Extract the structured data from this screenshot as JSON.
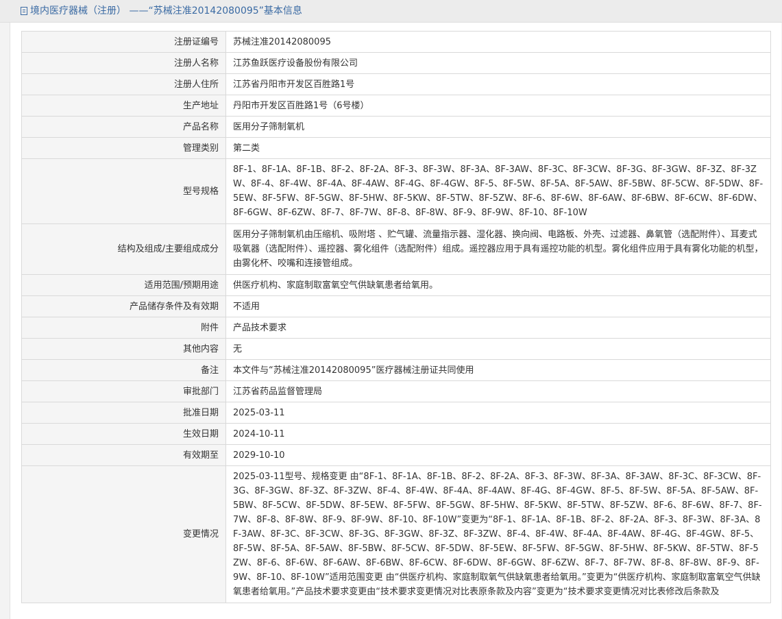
{
  "header": {
    "icon": "document-icon",
    "title": "境内医疗器械（注册） ——“苏械注准20142080095”基本信息"
  },
  "rows": [
    {
      "label": "注册证编号",
      "value": "苏械注准20142080095"
    },
    {
      "label": "注册人名称",
      "value": "江苏鱼跃医疗设备股份有限公司"
    },
    {
      "label": "注册人住所",
      "value": "江苏省丹阳市开发区百胜路1号"
    },
    {
      "label": "生产地址",
      "value": "丹阳市开发区百胜路1号（6号楼）"
    },
    {
      "label": "产品名称",
      "value": "医用分子筛制氧机"
    },
    {
      "label": "管理类别",
      "value": "第二类"
    },
    {
      "label": "型号规格",
      "value": "8F-1、8F-1A、8F-1B、8F-2、8F-2A、8F-3、8F-3W、8F-3A、8F-3AW、8F-3C、8F-3CW、8F-3G、8F-3GW、8F-3Z、8F-3ZW、8F-4、8F-4W、8F-4A、8F-4AW、8F-4G、8F-4GW、8F-5、8F-5W、8F-5A、8F-5AW、8F-5BW、8F-5CW、8F-5DW、8F-5EW、8F-5FW、8F-5GW、8F-5HW、8F-5KW、8F-5TW、8F-5ZW、8F-6、8F-6W、8F-6AW、8F-6BW、8F-6CW、8F-6DW、8F-6GW、8F-6ZW、8F-7、8F-7W、8F-8、8F-8W、8F-9、8F-9W、8F-10、8F-10W"
    },
    {
      "label": "结构及组成/主要组成成分",
      "value": "医用分子筛制氧机由压缩机、吸附塔 、贮气罐、流量指示器、湿化器、换向阀、电路板、外壳、过滤器、鼻氧管（选配附件）、耳麦式吸氧器（选配附件）、遥控器、雾化组件（选配附件）组成。遥控器应用于具有遥控功能的机型。雾化组件应用于具有雾化功能的机型，由雾化杯、咬嘴和连接管组成。"
    },
    {
      "label": "适用范围/预期用途",
      "value": "供医疗机构、家庭制取富氧空气供缺氧患者给氧用。"
    },
    {
      "label": "产品储存条件及有效期",
      "value": "不适用"
    },
    {
      "label": "附件",
      "value": "产品技术要求"
    },
    {
      "label": "其他内容",
      "value": "无"
    },
    {
      "label": "备注",
      "value": "本文件与“苏械注准20142080095”医疗器械注册证共同使用"
    },
    {
      "label": "审批部门",
      "value": "江苏省药品监督管理局"
    },
    {
      "label": "批准日期",
      "value": "2025-03-11"
    },
    {
      "label": "生效日期",
      "value": "2024-10-11"
    },
    {
      "label": "有效期至",
      "value": "2029-10-10"
    },
    {
      "label": "变更情况",
      "value": "2025-03-11型号、规格变更 由“8F-1、8F-1A、8F-1B、8F-2、8F-2A、8F-3、8F-3W、8F-3A、8F-3AW、8F-3C、8F-3CW、8F-3G、8F-3GW、8F-3Z、8F-3ZW、8F-4、8F-4W、8F-4A、8F-4AW、8F-4G、8F-4GW、8F-5、8F-5W、8F-5A、8F-5AW、8F-5BW、8F-5CW、8F-5DW、8F-5EW、8F-5FW、8F-5GW、8F-5HW、8F-5KW、8F-5TW、8F-5ZW、8F-6、8F-6W、8F-7、8F-7W、8F-8、8F-8W、8F-9、8F-9W、8F-10、8F-10W”变更为“8F-1、8F-1A、8F-1B、8F-2、8F-2A、8F-3、8F-3W、8F-3A、8F-3AW、8F-3C、8F-3CW、8F-3G、8F-3GW、8F-3Z、8F-3ZW、8F-4、8F-4W、8F-4A、8F-4AW、8F-4G、8F-4GW、8F-5、8F-5W、8F-5A、8F-5AW、8F-5BW、8F-5CW、8F-5DW、8F-5EW、8F-5FW、8F-5GW、8F-5HW、8F-5KW、8F-5TW、8F-5ZW、8F-6、8F-6W、8F-6AW、8F-6BW、8F-6CW、8F-6DW、8F-6GW、8F-6ZW、8F-7、8F-7W、8F-8、8F-8W、8F-9、8F-9W、8F-10、8F-10W”适用范围变更 由“供医疗机构、家庭制取氧气供缺氧患者给氧用。”变更为“供医疗机构、家庭制取富氧空气供缺氧患者给氧用。”产品技术要求变更由“技术要求变更情况对比表原条款及内容”变更为“技术要求变更情况对比表修改后条款及"
    }
  ]
}
